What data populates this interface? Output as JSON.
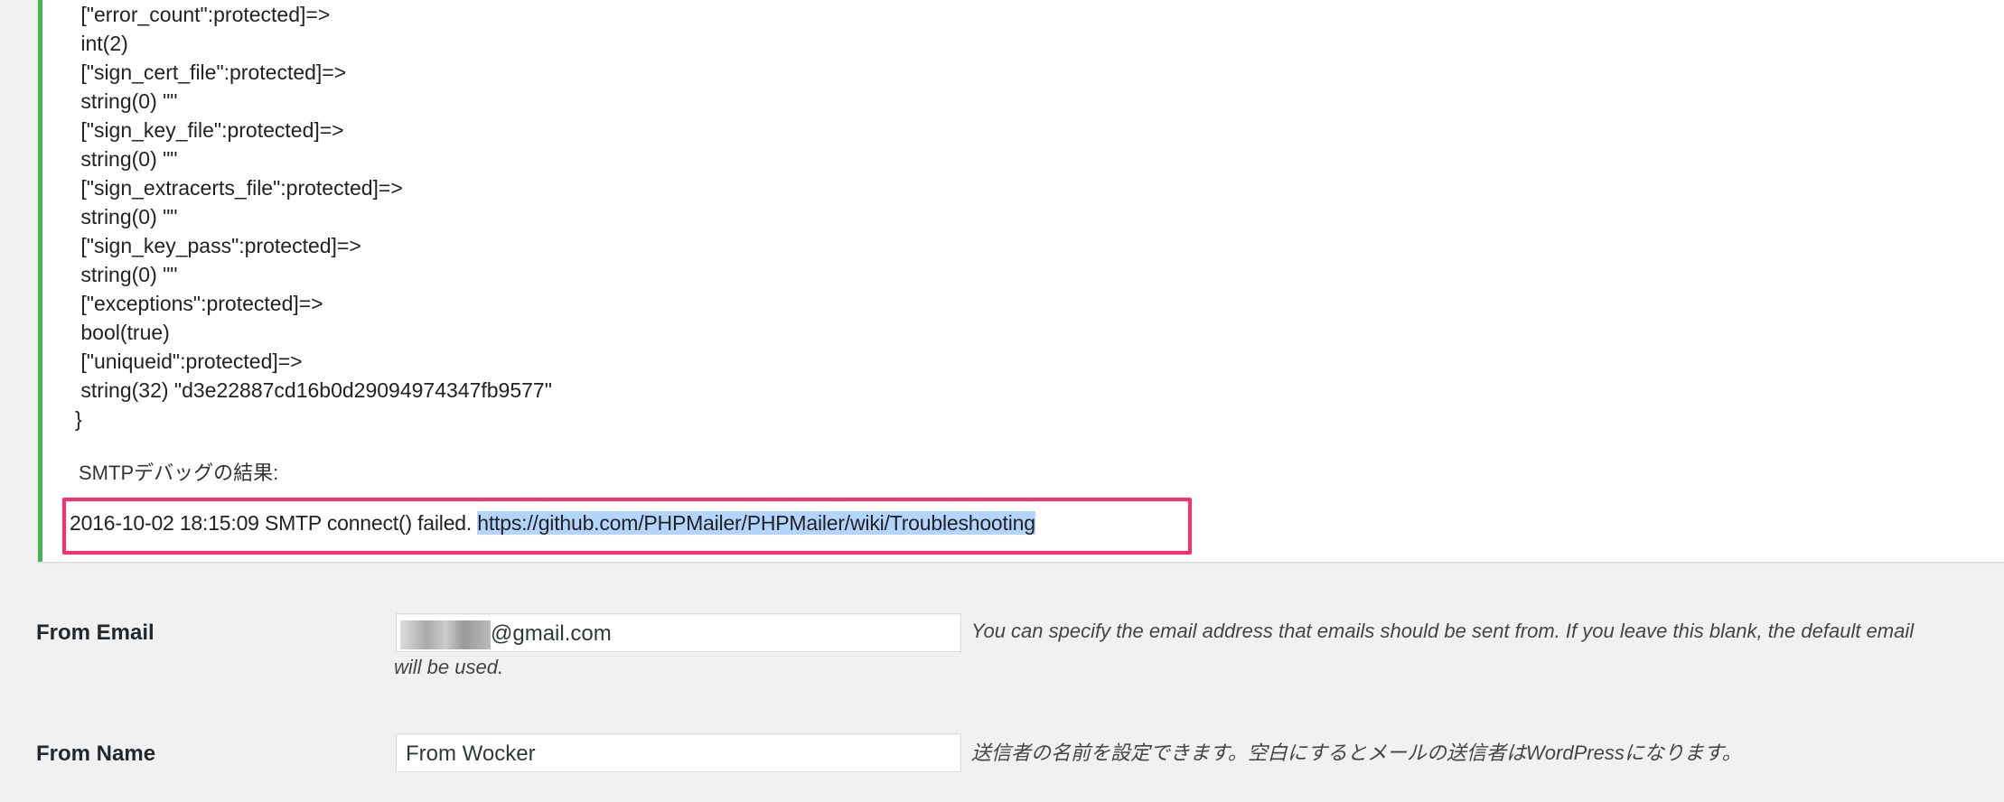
{
  "debug_output": {
    "lines": [
      " [\"error_count\":protected]=>",
      " int(2)",
      " [\"sign_cert_file\":protected]=>",
      " string(0) \"\"",
      " [\"sign_key_file\":protected]=>",
      " string(0) \"\"",
      " [\"sign_extracerts_file\":protected]=>",
      " string(0) \"\"",
      " [\"sign_key_pass\":protected]=>",
      " string(0) \"\"",
      " [\"exceptions\":protected]=>",
      " bool(true)",
      " [\"uniqueid\":protected]=>",
      " string(32) \"d3e22887cd16b0d29094974347fb9577\"",
      "}"
    ],
    "smtp_debug_label": "SMTPデバッグの結果:",
    "result_text": "2016-10-02 18:15:09 SMTP connect() failed. ",
    "result_link": "https://github.com/PHPMailer/PHPMailer/wiki/Troubleshooting"
  },
  "form": {
    "from_email": {
      "label": "From Email",
      "value": "@gmail.com",
      "description": "You can specify the email address that emails should be sent from. If you leave this blank, the default email",
      "description_cont": "will be used."
    },
    "from_name": {
      "label": "From Name",
      "value": "From Wocker",
      "description": "送信者の名前を設定できます。空白にするとメールの送信者はWordPressになります。"
    }
  },
  "colors": {
    "success_border": "#46b450",
    "highlight_box": "#ff2d6d",
    "selection": "#b3d4fc"
  }
}
